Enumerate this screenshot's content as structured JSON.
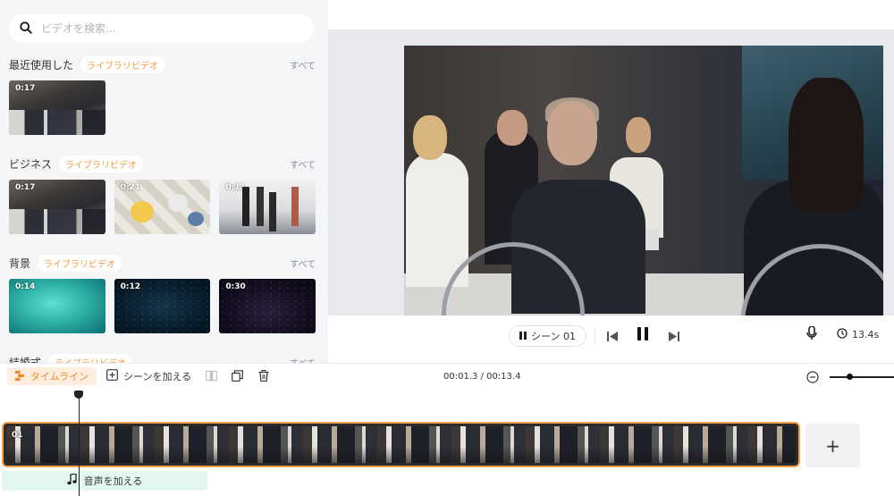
{
  "search": {
    "placeholder": "ビデオを検索..."
  },
  "sections": [
    {
      "title": "最近使用した",
      "badge": "ライブラリビデオ",
      "see_all": "すべて",
      "thumbs": [
        {
          "duration": "0:17"
        }
      ]
    },
    {
      "title": "ビジネス",
      "badge": "ライブラリビデオ",
      "see_all": "すべて",
      "thumbs": [
        {
          "duration": "0:17"
        },
        {
          "duration": "0:21"
        },
        {
          "duration": "0:11"
        }
      ]
    },
    {
      "title": "背景",
      "badge": "ライブラリビデオ",
      "see_all": "すべて",
      "thumbs": [
        {
          "duration": "0:14"
        },
        {
          "duration": "0:12"
        },
        {
          "duration": "0:30"
        }
      ]
    },
    {
      "title": "結婚式",
      "badge": "ライブラリビデオ",
      "see_all": "すべて"
    }
  ],
  "preview": {
    "scene_label": "シーン 01",
    "duration": "13.4s"
  },
  "toolbar": {
    "timeline_label": "タイムライン",
    "add_scene_label": "シーンを加える",
    "timecode": "00:01.3 / 00:13.4"
  },
  "timeline": {
    "clip_label": "01",
    "add_clip_label": "+",
    "add_audio_label": "音声を加える"
  },
  "colors": {
    "accent": "#f08a24",
    "clip_border": "#f5a34a",
    "audio_bg": "#e4f7ef"
  }
}
